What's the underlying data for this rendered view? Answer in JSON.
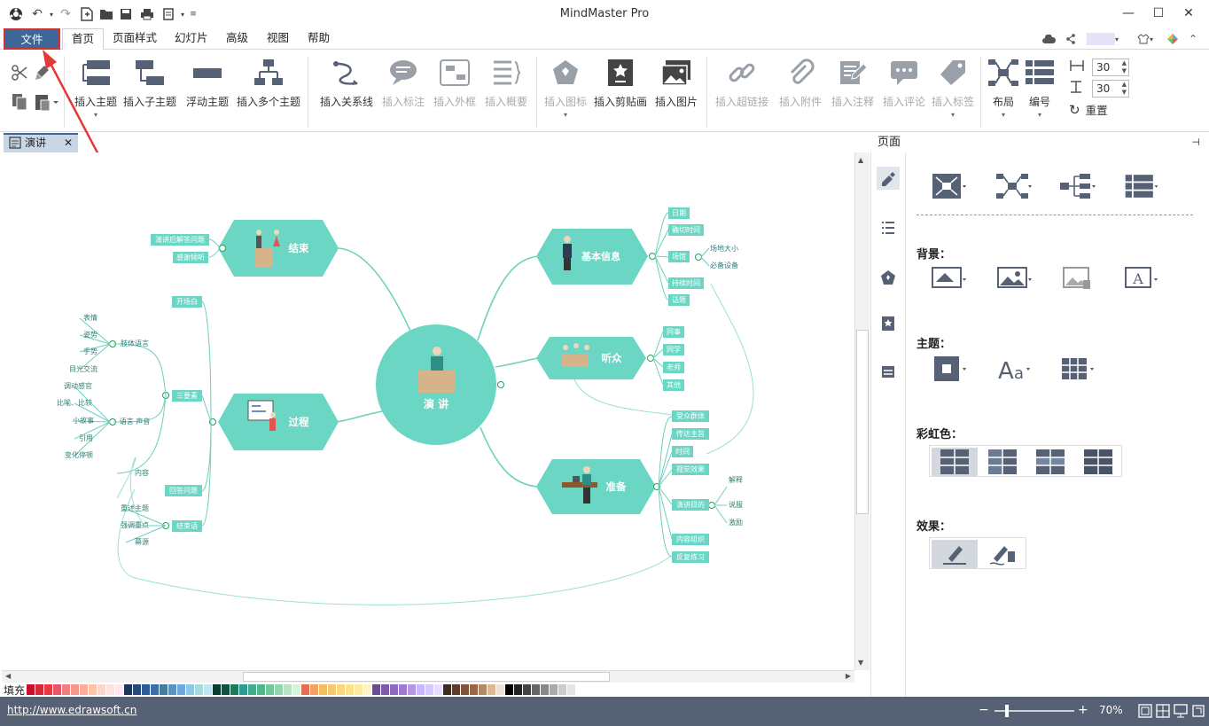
{
  "app": {
    "title": "MindMaster Pro"
  },
  "menu": {
    "file": "文件",
    "tabs": [
      "首页",
      "页面样式",
      "幻灯片",
      "高级",
      "视图",
      "帮助"
    ]
  },
  "ribbon": {
    "insert_topic": "插入主题",
    "insert_subtopic": "插入子主题",
    "floating_topic": "浮动主题",
    "insert_multiple": "插入多个主题",
    "insert_relation": "插入关系线",
    "insert_callout": "插入标注",
    "insert_boundary": "插入外框",
    "insert_summary": "插入概要",
    "insert_icon": "插入图标",
    "insert_clipart": "插入剪贴画",
    "insert_image": "插入图片",
    "insert_hyperlink": "插入超链接",
    "insert_attachment": "插入附件",
    "insert_note": "插入注释",
    "insert_comment": "插入评论",
    "insert_tag": "插入标签",
    "layout": "布局",
    "numbering": "编号",
    "spacing_h": "30",
    "spacing_v": "30",
    "reset": "重置"
  },
  "document_tab": "演讲",
  "panel": {
    "header": "页面",
    "background": "背景：",
    "theme": "主题：",
    "rainbow": "彩虹色：",
    "effect": "效果："
  },
  "mindmap": {
    "center": "演    讲",
    "topics": {
      "end": "结束",
      "process": "过程",
      "basic_info": "基本信息",
      "audience": "听众",
      "prepare": "准备"
    },
    "end_items": [
      "演讲后解答问题",
      "感谢倾听"
    ],
    "basic_items": [
      "日期",
      "确切时间",
      "场馆",
      "持续时间",
      "话题"
    ],
    "venue_items": [
      "场地大小",
      "必备设备"
    ],
    "audience_items": [
      "同事",
      "同学",
      "老师",
      "其他"
    ],
    "prepare_items": [
      "受众群体",
      "传达主旨",
      "时间",
      "视觉效果",
      "演讲目的",
      "内容组织",
      "反复练习"
    ],
    "purpose_items": [
      "解释",
      "说服",
      "激励"
    ],
    "process_items": [
      "开场白",
      "三要素",
      "回答问题",
      "结束语"
    ],
    "body_language": "肢体语言",
    "body_items": [
      "表情",
      "姿势",
      "手势",
      "目光交流"
    ],
    "voice": "语言 声音",
    "voice_items": [
      "调动感官",
      "比喻、比较",
      "小故事",
      "引用",
      "变化停顿"
    ],
    "content": "内容",
    "closing_items": [
      "重述主题",
      "强调重点",
      "幕源"
    ]
  },
  "palette_label": "填充",
  "status": {
    "url": "http://www.edrawsoft.cn",
    "zoom": "70%"
  },
  "colors": {
    "accent": "#3e6799",
    "node": "#6bd6c4",
    "line": "#6fcfbd",
    "status": "#566175"
  }
}
